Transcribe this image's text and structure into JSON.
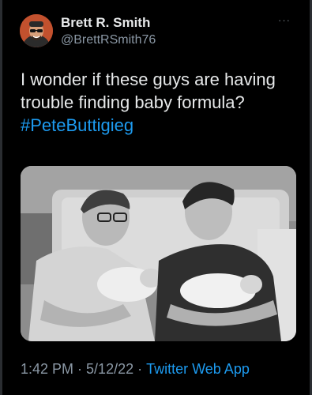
{
  "tweet": {
    "display_name": "Brett R. Smith",
    "handle": "@BrettRSmith76",
    "more": "···",
    "text_prefix": "I wonder if these guys are having trouble finding baby formula? ",
    "hashtag": "#PeteButtigieg",
    "time": "1:42 PM",
    "separator_1": "·",
    "date": "5/12/22",
    "separator_2": "·",
    "app": "Twitter Web App"
  },
  "colors": {
    "background": "#000000",
    "text": "#e7e9ea",
    "secondary": "#8b98a5",
    "link": "#1d9bf0"
  },
  "icons": {
    "more": "more-dots-icon"
  }
}
